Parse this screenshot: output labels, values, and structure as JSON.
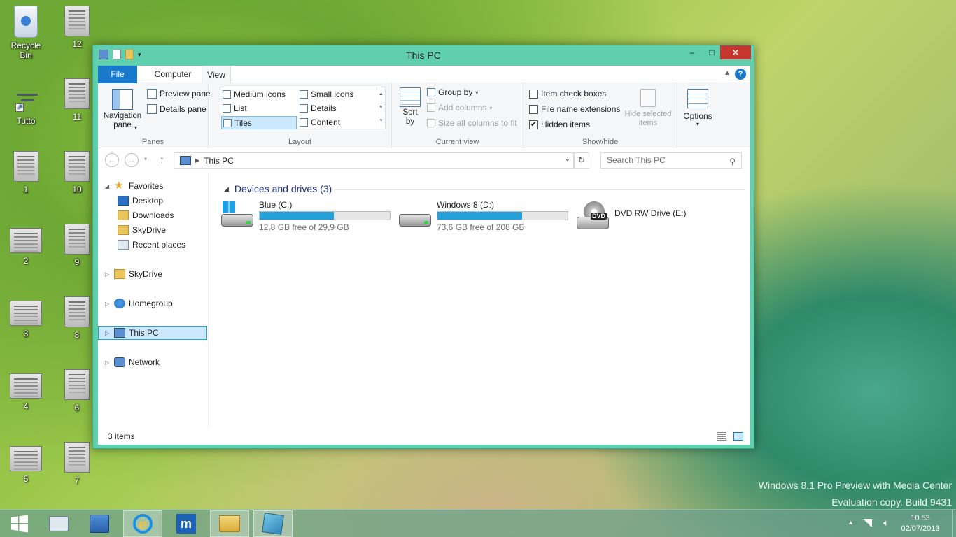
{
  "desktop": {
    "icons": [
      {
        "label": "Recycle Bin"
      },
      {
        "label": "12"
      },
      {
        "label": "Tutto"
      },
      {
        "label": "11"
      },
      {
        "label": "1"
      },
      {
        "label": "10"
      },
      {
        "label": "2"
      },
      {
        "label": "9"
      },
      {
        "label": "3"
      },
      {
        "label": "8"
      },
      {
        "label": "4"
      },
      {
        "label": "6"
      },
      {
        "label": "5"
      },
      {
        "label": "7"
      }
    ],
    "watermark": {
      "line1": "Windows 8.1 Pro Preview with Media Center",
      "line2": "Evaluation copy. Build 9431"
    }
  },
  "window": {
    "title": "This PC",
    "accent": "#5fcfae",
    "controls": {
      "min": "–",
      "max": "□",
      "close": "✕"
    },
    "tabs": {
      "file": "File",
      "computer": "Computer",
      "view": "View"
    },
    "ribbon": {
      "panes": {
        "label": "Panes",
        "nav_pane": "Navigation pane",
        "preview_pane": "Preview pane",
        "details_pane": "Details pane"
      },
      "layout": {
        "label": "Layout",
        "medium_icons": "Medium icons",
        "small_icons": "Small icons",
        "list": "List",
        "details": "Details",
        "tiles": "Tiles",
        "content": "Content"
      },
      "current_view": {
        "label": "Current view",
        "sort_by": "Sort by",
        "group_by": "Group by",
        "add_columns": "Add columns",
        "size_columns": "Size all columns to fit"
      },
      "show_hide": {
        "label": "Show/hide",
        "item_check_boxes": "Item check boxes",
        "file_name_extensions": "File name extensions",
        "hidden_items": "Hidden items",
        "hidden_items_checked": true,
        "hide_selected": "Hide selected items"
      },
      "options": "Options"
    },
    "address": {
      "path": "This PC"
    },
    "search": {
      "placeholder": "Search This PC"
    },
    "nav": {
      "favorites": "Favorites",
      "desktop": "Desktop",
      "downloads": "Downloads",
      "skydrive_fav": "SkyDrive",
      "recent": "Recent places",
      "skydrive": "SkyDrive",
      "homegroup": "Homegroup",
      "thispc": "This PC",
      "network": "Network"
    },
    "group": {
      "title": "Devices and drives (3)"
    },
    "drives": [
      {
        "name": "Blue (C:)",
        "free": "12,8 GB free of 29,9 GB",
        "used_fraction": 0.57
      },
      {
        "name": "Windows 8 (D:)",
        "free": "73,6 GB free of 208 GB",
        "used_fraction": 0.65
      },
      {
        "name": "DVD RW Drive (E:)",
        "badge": "DVD"
      }
    ],
    "status": {
      "items": "3 items"
    }
  },
  "taskbar": {
    "clock": {
      "time": "10.53",
      "date": "02/07/2013"
    }
  }
}
